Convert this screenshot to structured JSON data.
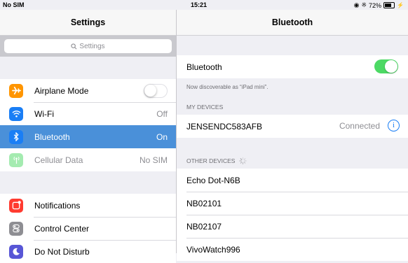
{
  "status_bar": {
    "carrier": "No SIM",
    "time": "15:21",
    "battery_pct": "72%",
    "battery_level": 0.72
  },
  "master": {
    "title": "Settings",
    "search_placeholder": "Settings",
    "groups": [
      [
        {
          "label": "Airplane Mode",
          "icon": "airplane-icon",
          "color": "#ff9500",
          "control": "toggle-off"
        },
        {
          "label": "Wi-Fi",
          "icon": "wifi-icon",
          "color": "#1a7ef5",
          "value": "Off"
        },
        {
          "label": "Bluetooth",
          "icon": "bluetooth-icon",
          "color": "#1a7ef5",
          "value": "On",
          "selected": true
        },
        {
          "label": "Cellular Data",
          "icon": "antenna-icon",
          "color": "#4cd964",
          "value": "No SIM",
          "disabled": true
        }
      ],
      [
        {
          "label": "Notifications",
          "icon": "notifications-icon",
          "color": "#ff3b30"
        },
        {
          "label": "Control Center",
          "icon": "control-center-icon",
          "color": "#8e8e93"
        },
        {
          "label": "Do Not Disturb",
          "icon": "moon-icon",
          "color": "#5856d6"
        }
      ]
    ]
  },
  "detail": {
    "title": "Bluetooth",
    "bluetooth_label": "Bluetooth",
    "bluetooth_on": true,
    "discoverable_note": "Now discoverable as “iPad mini”.",
    "my_devices_header": "MY DEVICES",
    "my_devices": [
      {
        "name": "JENSENDC583AFB",
        "status": "Connected"
      }
    ],
    "other_devices_header": "OTHER DEVICES",
    "other_devices": [
      "Echo Dot-N6B",
      "NB02101",
      "NB02107",
      "VivoWatch996"
    ]
  }
}
